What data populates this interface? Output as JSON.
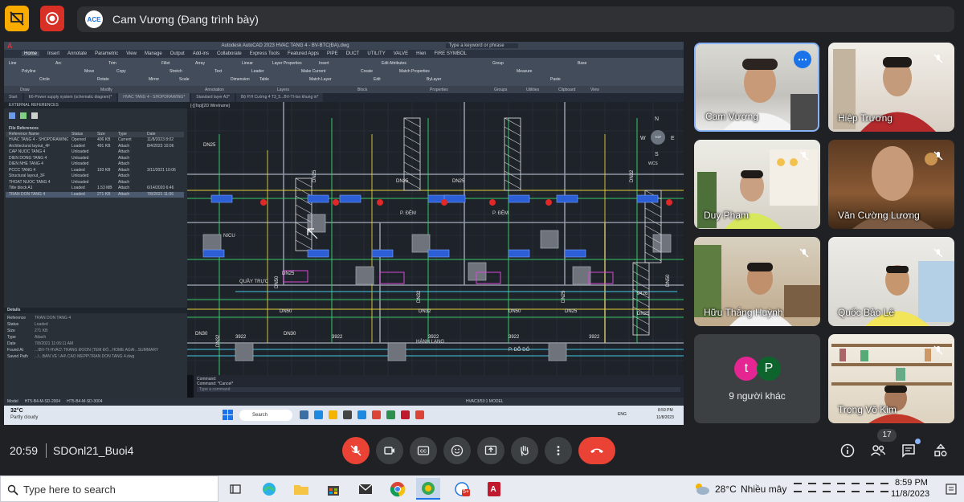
{
  "meet": {
    "presenter_banner": "Cam Vương (Đang trình bày)",
    "presenter_logo": "ACE",
    "time": "20:59",
    "meeting_code": "SDOnl21_Buoi4",
    "people_count": "17"
  },
  "participants": [
    {
      "name": "Cam Vương"
    },
    {
      "name": "Hiệp Trương"
    },
    {
      "name": "Duy Phạm"
    },
    {
      "name": "Văn Cường Lương"
    },
    {
      "name": "Hữu Thắng Huỳnh"
    },
    {
      "name": "Quốc Bảo Lê"
    },
    {
      "name": "Trọng Võ Kim"
    }
  ],
  "others": {
    "label": "9 người khác",
    "avatars": [
      "t",
      "P"
    ]
  },
  "autocad": {
    "title": "Autodesk AutoCAD 2023    HVAC TANG 4 - BV-BTC(ĐA).dwg",
    "search_placeholder": "Type a keyword or phrase",
    "menu": [
      "Home",
      "Insert",
      "Annotate",
      "Parametric",
      "View",
      "Manage",
      "Output",
      "Add-ins",
      "Collaborate",
      "Express Tools",
      "Featured Apps",
      "PIPE",
      "DUCT",
      "UTILITY",
      "VALVE",
      "Hien",
      "FIRE SYMBOL"
    ],
    "ribbon_panels": [
      "Draw",
      "Modify",
      "Annotation",
      "Layers",
      "Block",
      "Properties",
      "Groups",
      "Utilities",
      "Clipboard",
      "View"
    ],
    "ribbon_tools": [
      "Line",
      "Polyline",
      "Circle",
      "Arc",
      "Move",
      "Rotate",
      "Trim",
      "Copy",
      "Mirror",
      "Fillet",
      "Stretch",
      "Scale",
      "Array",
      "Text",
      "Dimension",
      "Linear",
      "Leader",
      "Table",
      "Layer Properties",
      "Make Current",
      "Match Layer",
      "Insert",
      "Create",
      "Edit",
      "Edit Attributes",
      "Match Properties",
      "ByLayer",
      "Group",
      "Measure",
      "Paste",
      "Base"
    ],
    "file_tabs": [
      "Start",
      "E6-Power supply system (schematic diagram)*",
      "HVAC TANG 4 - SHOPDRAWING*",
      "Standard layer A3*",
      "Bộ P.H Cường 4 T3_5...BV-TI-Iso khung in*"
    ],
    "xref_title": "EXTERNAL REFERENCES",
    "file_references_label": "File References",
    "xref_columns": [
      "Reference Name",
      "Status",
      "Size",
      "Type",
      "Date"
    ],
    "xrefs": [
      [
        "HVAC TANG 4 - SHOPDRAWING*",
        "Opened",
        "406 KB",
        "Current",
        "11/8/2023 8:02"
      ],
      [
        "Architectural layout_4F",
        "Loaded",
        "491 KB",
        "Attach",
        "8/4/2023 10:06"
      ],
      [
        "CAP NUOC TANG 4",
        "Unloaded",
        "",
        "Attach",
        ""
      ],
      [
        "DIEN DONG TANG 4",
        "Unloaded",
        "",
        "Attach",
        ""
      ],
      [
        "DIEN NHE TANG 4",
        "Unloaded",
        "",
        "Attach",
        ""
      ],
      [
        "PCCC TANG 4",
        "Loaded",
        "193 KB",
        "Attach",
        "3/11/2021 10:06"
      ],
      [
        "Structural layout_3F",
        "Unloaded",
        "",
        "Attach",
        ""
      ],
      [
        "THOAT NUOC TANG 4",
        "Unloaded",
        "",
        "Attach",
        ""
      ],
      [
        "Title block A1",
        "Loaded",
        "1.53 MB",
        "Attach",
        "6/14/2020 6:46"
      ],
      [
        "TRAN DON TANG 4",
        "Loaded",
        "271 KB",
        "Attach",
        "7/8/2021 11:06"
      ]
    ],
    "details_label": "Details",
    "details": [
      [
        "Reference",
        "TRAN DON TANG 4"
      ],
      [
        "Status",
        "Loaded"
      ],
      [
        "Size",
        "271 KB"
      ],
      [
        "Type",
        "Attach"
      ],
      [
        "Date",
        "7/8/2021 11:06:11 AM"
      ],
      [
        "Found At",
        "...\\BV-TI-HVAC\\ TRANG ĐOON (TEM ĐÓ...HOME AGAI...SUMMARY"
      ],
      [
        "Saved Path",
        "...\\...BAN VE \\ A4\\ CAO MEPP\\TRAN DON TANG 4.dwg"
      ]
    ],
    "viewport_label": "[-][Top][2D Wireframe]",
    "compass": [
      "N",
      "W",
      "TOP",
      "E",
      "S"
    ],
    "viewcube_label": "WCS",
    "drawing_labels": [
      "DN25",
      "DN25",
      "DN25",
      "DN25",
      "DN32",
      "P. ĐỆM",
      "P. ĐỆM",
      "NICU",
      "QUẦY TRỰC",
      "DN25",
      "DN50",
      "DN50",
      "DN32",
      "DN32",
      "DN50",
      "DN25",
      "DN25",
      "DN30",
      "DN30",
      "DN32",
      "HÀNH LANG",
      "P. DỖ DỎ",
      "DN50",
      "DN25",
      "3922",
      "3922",
      "3922",
      "3922",
      "3922",
      "9426"
    ],
    "command_label": "Command:",
    "command_history": "Command: *Cancel*",
    "command_placeholder": "Type a command",
    "status_tabs": [
      "Model",
      "HT5-B4-M-SD-2004",
      "HT5-B4-M-SD-3004"
    ],
    "status_right": "HVAC3/53:1    MODEL",
    "weather_temp": "32°C",
    "weather_desc": "Partly cloudy",
    "search_label": "Search",
    "tray_lang": "ENG",
    "tray_time": "8:59 PM",
    "tray_date": "11/8/2023"
  },
  "windows": {
    "search_placeholder": "Type here to search",
    "temperature": "28°C",
    "weather": "Nhiều mây",
    "time": "8:59 PM",
    "date": "11/8/2023",
    "chrome_badge": "5+"
  },
  "colors": {
    "meet_bg": "#202124",
    "hangup": "#ea4335",
    "yellow_btn": "#f9ab00",
    "red_btn": "#d93025",
    "active_border": "#8ab4f8"
  }
}
